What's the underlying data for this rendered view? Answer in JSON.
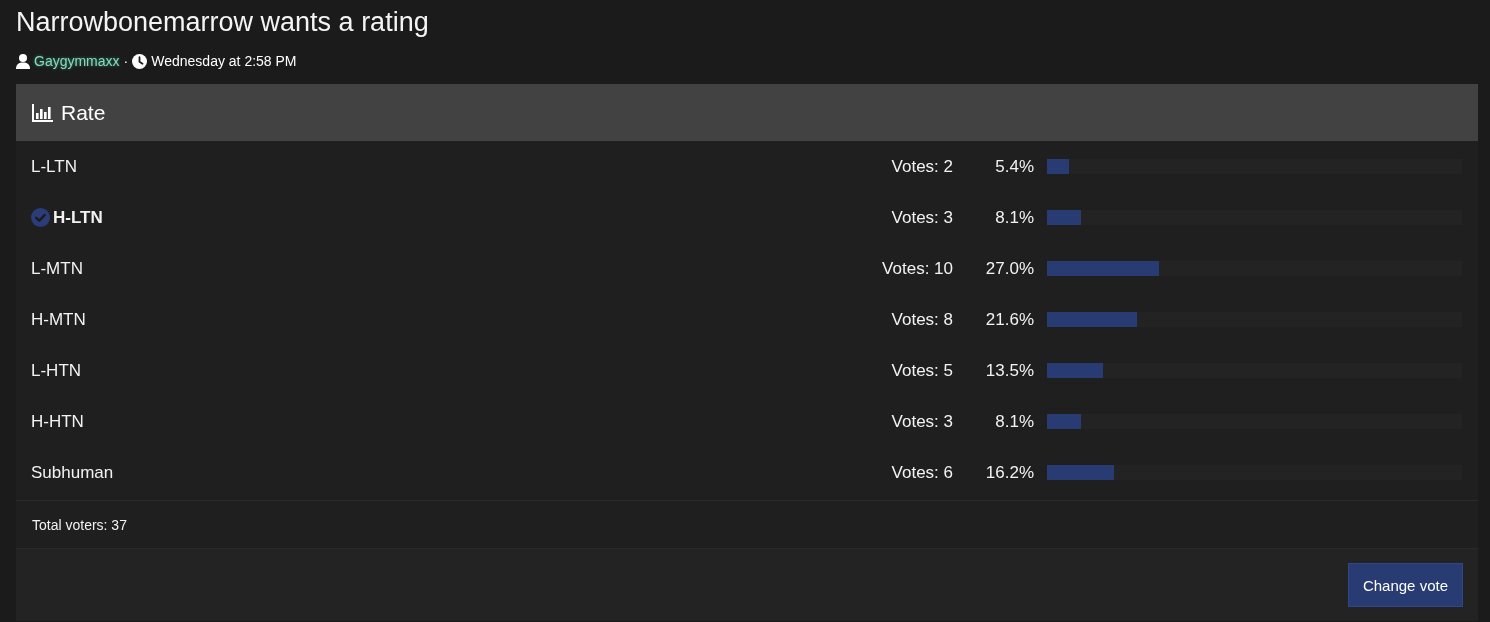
{
  "thread": {
    "title": "Narrowbonemarrow wants a rating",
    "author": "Gaygymmaxx",
    "separator": "·",
    "date": "Wednesday at 2:58 PM"
  },
  "poll": {
    "title": "Rate",
    "options": [
      {
        "label": "L-LTN",
        "votes": "Votes: 2",
        "percent": "5.4%",
        "level": 0.054,
        "selected": false
      },
      {
        "label": "H-LTN",
        "votes": "Votes: 3",
        "percent": "8.1%",
        "level": 0.081,
        "selected": true
      },
      {
        "label": "L-MTN",
        "votes": "Votes: 10",
        "percent": "27.0%",
        "level": 0.27,
        "selected": false
      },
      {
        "label": "H-MTN",
        "votes": "Votes: 8",
        "percent": "21.6%",
        "level": 0.216,
        "selected": false
      },
      {
        "label": "L-HTN",
        "votes": "Votes: 5",
        "percent": "13.5%",
        "level": 0.135,
        "selected": false
      },
      {
        "label": "H-HTN",
        "votes": "Votes: 3",
        "percent": "8.1%",
        "level": 0.081,
        "selected": false
      },
      {
        "label": "Subhuman",
        "votes": "Votes: 6",
        "percent": "16.2%",
        "level": 0.162,
        "selected": false
      }
    ],
    "total": "Total voters: 37",
    "button": "Change vote"
  }
}
